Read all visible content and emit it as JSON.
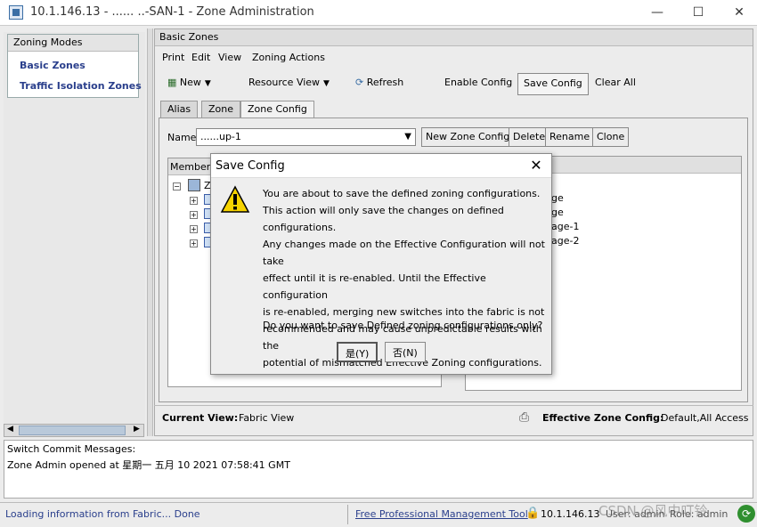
{
  "window": {
    "title": "10.1.146.13 - ...... ..-SAN-1 - Zone Administration",
    "minimize": "—",
    "maximize": "☐",
    "close": "✕"
  },
  "left": {
    "panel_title": "Zoning Modes",
    "modes": [
      "Basic Zones",
      "Traffic Isolation Zones"
    ]
  },
  "main": {
    "panel_title": "Basic Zones",
    "menu": [
      "Print",
      "Edit",
      "View",
      "Zoning Actions"
    ],
    "toolbar": {
      "new": "New",
      "resource_view": "Resource View",
      "refresh": "Refresh",
      "enable_config": "Enable Config",
      "save_config": "Save Config",
      "clear_all": "Clear All"
    },
    "tabs": [
      "Alias",
      "Zone",
      "Zone Config"
    ],
    "name_label": "Name",
    "name_value": "......up-1",
    "buttons": {
      "new_zone_config": "New Zone Config",
      "delete": "Delete",
      "rename": "Rename",
      "clone": "Clone"
    },
    "members_title": "Member S",
    "tree_root": "Z",
    "right_title": "ers",
    "right_items": [
      "ge",
      "ge",
      "age-1",
      "age-2"
    ],
    "current_view_label": "Current View:",
    "current_view_value": "Fabric View",
    "effective_label": "Effective Zone Config:",
    "effective_value": "Default,All Access"
  },
  "messages": {
    "title": "Switch Commit Messages:",
    "line": "Zone Admin opened at 星期一 五月 10 2021 07:58:41 GMT"
  },
  "statusbar": {
    "loading": "Loading information from Fabric... Done",
    "link": "Free Professional Management Tool",
    "ip": "10.1.146.13",
    "user": "User: admin",
    "role": "Role: admin",
    "watermark": "CSDN @风中叮铃"
  },
  "dialog": {
    "title": "Save Config",
    "lines": [
      "You are about to save the defined zoning configurations.",
      "This action will only save the changes on defined configurations.",
      "Any changes made on the Effective Configuration will not take",
      "effect until it is re-enabled. Until the Effective configuration",
      "is re-enabled, merging new switches into the fabric is not",
      "recommended and may cause unpredictable results with the",
      "potential of mismatched Effective Zoning configurations."
    ],
    "question": "Do you want to save Defined zoning configurations only?",
    "yes": "是(Y)",
    "no": "否(N)"
  }
}
